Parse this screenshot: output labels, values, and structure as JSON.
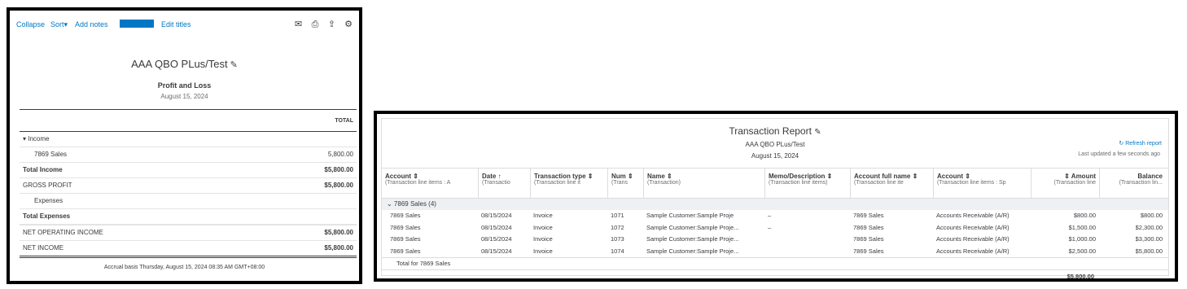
{
  "pl": {
    "toolbar": {
      "collapse": "Collapse",
      "sort": "Sort▾",
      "add_notes": "Add notes",
      "edit_titles": "Edit titles"
    },
    "company": "AAA QBO PLus/Test",
    "title": "Profit and Loss",
    "date": "August 15, 2024",
    "total_header": "TOTAL",
    "rows": [
      {
        "label": "▾ Income",
        "value": ""
      },
      {
        "label": "7869 Sales",
        "value": "5,800.00"
      },
      {
        "label": "Total Income",
        "value": "$5,800.00"
      },
      {
        "label": "GROSS PROFIT",
        "value": "$5,800.00"
      },
      {
        "label": "Expenses",
        "value": ""
      },
      {
        "label": "Total Expenses",
        "value": ""
      },
      {
        "label": "NET OPERATING INCOME",
        "value": "$5,800.00"
      },
      {
        "label": "NET INCOME",
        "value": "$5,800.00"
      }
    ],
    "footer": "Accrual basis  Thursday, August 15, 2024  08:35 AM GMT+08:00"
  },
  "tr": {
    "title": "Transaction Report",
    "company": "AAA QBO PLus/Test",
    "date": "August 15, 2024",
    "refresh": "Refresh report",
    "updated": "Last updated a few seconds ago",
    "columns": [
      {
        "title": "Account ⇕",
        "sub": "(Transaction line items : A"
      },
      {
        "title": "Date ↑",
        "sub": "(Transactio"
      },
      {
        "title": "Transaction type ⇕",
        "sub": "(Transaction line it"
      },
      {
        "title": "Num ⇕",
        "sub": "(Trans"
      },
      {
        "title": "Name ⇕",
        "sub": "(Transaction)"
      },
      {
        "title": "Memo/Description ⇕",
        "sub": "(Transaction line items)"
      },
      {
        "title": "Account full name ⇕",
        "sub": "(Transaction line ite"
      },
      {
        "title": "Account ⇕",
        "sub": "(Transaction line items : Sp"
      },
      {
        "title": "⇕ Amount",
        "sub": "(Transaction line"
      },
      {
        "title": "Balance",
        "sub": "(Transaction lin..."
      }
    ],
    "group": "⌄ 7869 Sales (4)",
    "rows": [
      {
        "account": "7869 Sales",
        "date": "08/15/2024",
        "type": "Invoice",
        "num": "1071",
        "name": "Sample Customer:Sample Proje",
        "memo": "–",
        "full": "7869 Sales",
        "split": "Accounts Receivable (A/R)",
        "amount": "$800.00",
        "balance": "$800.00"
      },
      {
        "account": "7869 Sales",
        "date": "08/15/2024",
        "type": "Invoice",
        "num": "1072",
        "name": "Sample Customer:Sample Proje...",
        "memo": "–",
        "full": "7869 Sales",
        "split": "Accounts Receivable (A/R)",
        "amount": "$1,500.00",
        "balance": "$2,300.00"
      },
      {
        "account": "7869 Sales",
        "date": "08/15/2024",
        "type": "Invoice",
        "num": "1073",
        "name": "Sample Customer:Sample Proje...",
        "memo": "",
        "full": "7869 Sales",
        "split": "Accounts Receivable (A/R)",
        "amount": "$1,000.00",
        "balance": "$3,300.00"
      },
      {
        "account": "7869 Sales",
        "date": "08/15/2024",
        "type": "Invoice",
        "num": "1074",
        "name": "Sample Customer:Sample Proje...",
        "memo": "",
        "full": "7869 Sales",
        "split": "Accounts Receivable (A/R)",
        "amount": "$2,500.00",
        "balance": "$5,800.00"
      }
    ],
    "total_label": "Total for 7869 Sales",
    "total_value": "$5,800.00",
    "grand_total": "$5,800.00"
  },
  "icons": [
    "mail-icon",
    "print-icon",
    "export-icon",
    "settings-icon",
    "pencil-icon",
    "refresh-icon"
  ],
  "colors": {
    "accent": "#0077c5",
    "text": "#393a3d"
  }
}
